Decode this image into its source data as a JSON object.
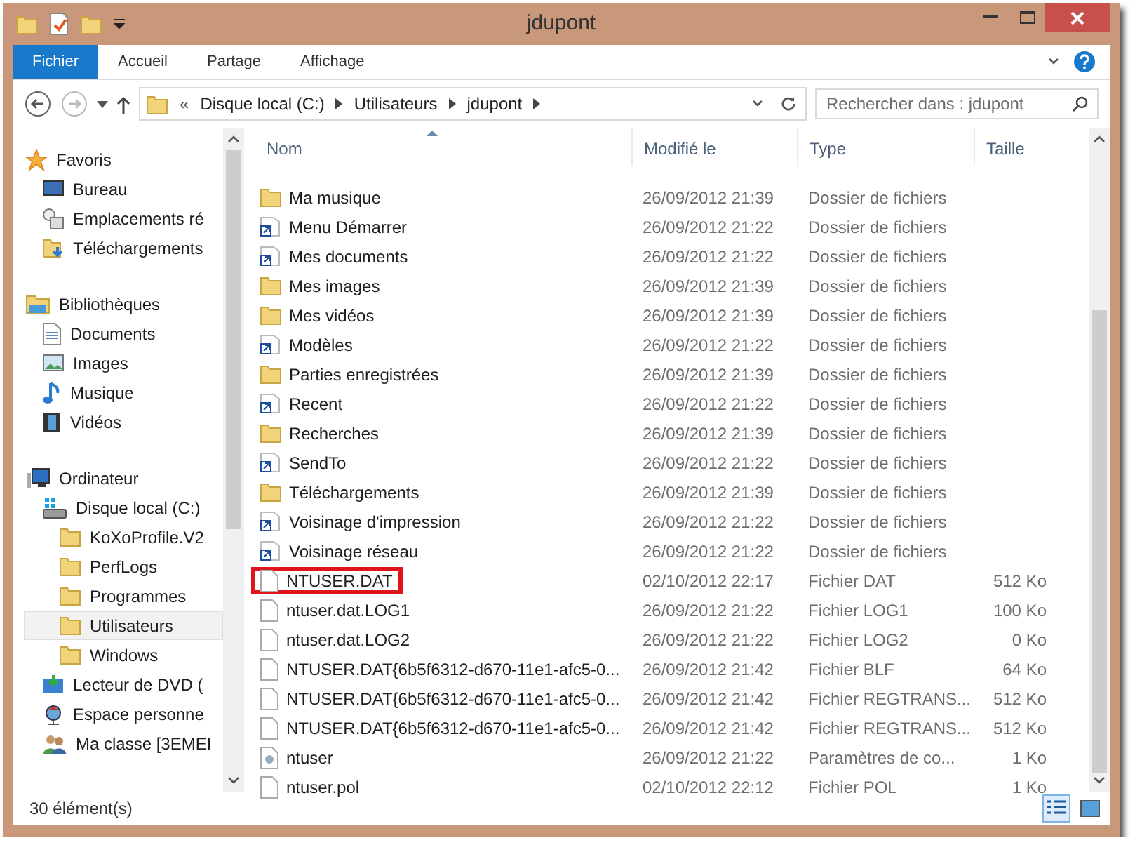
{
  "window": {
    "title": "jdupont"
  },
  "ribbon_tabs": [
    {
      "label": "Fichier",
      "selected": true
    },
    {
      "label": "Accueil",
      "selected": false
    },
    {
      "label": "Partage",
      "selected": false
    },
    {
      "label": "Affichage",
      "selected": false
    }
  ],
  "breadcrumb": {
    "overflow": "«",
    "parts": [
      "Disque local (C:)",
      "Utilisateurs",
      "jdupont"
    ]
  },
  "search": {
    "placeholder": "Rechercher dans : jdupont"
  },
  "sidebar": {
    "groups": [
      {
        "label": "Favoris",
        "kind": "star",
        "selected": false,
        "children": [
          {
            "label": "Bureau",
            "kind": "desktop",
            "selected": false
          },
          {
            "label": "Emplacements ré",
            "kind": "places",
            "selected": false
          },
          {
            "label": "Téléchargements",
            "kind": "downloads",
            "selected": false
          }
        ]
      },
      {
        "label": "Bibliothèques",
        "kind": "library",
        "selected": false,
        "children": [
          {
            "label": "Documents",
            "kind": "document",
            "selected": false
          },
          {
            "label": "Images",
            "kind": "picture",
            "selected": false
          },
          {
            "label": "Musique",
            "kind": "music",
            "selected": false
          },
          {
            "label": "Vidéos",
            "kind": "film",
            "selected": false
          }
        ]
      },
      {
        "label": "Ordinateur",
        "kind": "computer",
        "selected": false,
        "children": [
          {
            "label": "Disque local (C:)",
            "kind": "drive",
            "selected": false,
            "children": [
              {
                "label": "KoXoProfile.V2",
                "kind": "folder",
                "selected": false
              },
              {
                "label": "PerfLogs",
                "kind": "folder",
                "selected": false
              },
              {
                "label": "Programmes",
                "kind": "folder",
                "selected": false
              },
              {
                "label": "Utilisateurs",
                "kind": "folder",
                "selected": true
              },
              {
                "label": "Windows",
                "kind": "folder",
                "selected": false
              }
            ]
          },
          {
            "label": "Lecteur de DVD (",
            "kind": "dvd",
            "selected": false
          },
          {
            "label": "Espace personne",
            "kind": "network",
            "selected": false
          },
          {
            "label": "Ma classe [3EMEI",
            "kind": "users",
            "selected": false
          }
        ]
      }
    ]
  },
  "table": {
    "columns": [
      "Nom",
      "Modifié le",
      "Type",
      "Taille"
    ],
    "rows": [
      {
        "name": "Ma musique",
        "modified": "26/09/2012 21:39",
        "type": "Dossier de fichiers",
        "kind": "folder",
        "highlighted": false
      },
      {
        "name": "Menu Démarrer",
        "modified": "26/09/2012 21:22",
        "type": "Dossier de fichiers",
        "kind": "shortcut",
        "highlighted": false
      },
      {
        "name": "Mes documents",
        "modified": "26/09/2012 21:22",
        "type": "Dossier de fichiers",
        "kind": "shortcut",
        "highlighted": false
      },
      {
        "name": "Mes images",
        "modified": "26/09/2012 21:39",
        "type": "Dossier de fichiers",
        "kind": "folder",
        "highlighted": false
      },
      {
        "name": "Mes vidéos",
        "modified": "26/09/2012 21:39",
        "type": "Dossier de fichiers",
        "kind": "folder",
        "highlighted": false
      },
      {
        "name": "Modèles",
        "modified": "26/09/2012 21:22",
        "type": "Dossier de fichiers",
        "kind": "shortcut",
        "highlighted": false
      },
      {
        "name": "Parties enregistrées",
        "modified": "26/09/2012 21:39",
        "type": "Dossier de fichiers",
        "kind": "folder",
        "highlighted": false
      },
      {
        "name": "Recent",
        "modified": "26/09/2012 21:22",
        "type": "Dossier de fichiers",
        "kind": "shortcut",
        "highlighted": false
      },
      {
        "name": "Recherches",
        "modified": "26/09/2012 21:39",
        "type": "Dossier de fichiers",
        "kind": "folder",
        "highlighted": false
      },
      {
        "name": "SendTo",
        "modified": "26/09/2012 21:22",
        "type": "Dossier de fichiers",
        "kind": "shortcut",
        "highlighted": false
      },
      {
        "name": "Téléchargements",
        "modified": "26/09/2012 21:39",
        "type": "Dossier de fichiers",
        "kind": "folder",
        "highlighted": false
      },
      {
        "name": "Voisinage d'impression",
        "modified": "26/09/2012 21:22",
        "type": "Dossier de fichiers",
        "kind": "shortcut",
        "highlighted": false
      },
      {
        "name": "Voisinage réseau",
        "modified": "26/09/2012 21:22",
        "type": "Dossier de fichiers",
        "kind": "shortcut",
        "highlighted": false
      },
      {
        "name": "NTUSER.DAT",
        "modified": "02/10/2012 22:17",
        "type": "Fichier DAT",
        "size": "512 Ko",
        "kind": "file",
        "highlighted": true
      },
      {
        "name": "ntuser.dat.LOG1",
        "modified": "26/09/2012 21:22",
        "type": "Fichier LOG1",
        "size": "100 Ko",
        "kind": "file",
        "highlighted": false
      },
      {
        "name": "ntuser.dat.LOG2",
        "modified": "26/09/2012 21:22",
        "type": "Fichier LOG2",
        "size": "0 Ko",
        "kind": "file",
        "highlighted": false
      },
      {
        "name": "NTUSER.DAT{6b5f6312-d670-11e1-afc5-0...",
        "modified": "26/09/2012 21:42",
        "type": "Fichier BLF",
        "size": "64 Ko",
        "kind": "file",
        "highlighted": false
      },
      {
        "name": "NTUSER.DAT{6b5f6312-d670-11e1-afc5-0...",
        "modified": "26/09/2012 21:42",
        "type": "Fichier REGTRANS...",
        "size": "512 Ko",
        "kind": "file",
        "highlighted": false
      },
      {
        "name": "NTUSER.DAT{6b5f6312-d670-11e1-afc5-0...",
        "modified": "26/09/2012 21:42",
        "type": "Fichier REGTRANS...",
        "size": "512 Ko",
        "kind": "file",
        "highlighted": false
      },
      {
        "name": "ntuser",
        "modified": "26/09/2012 21:22",
        "type": "Paramètres de co...",
        "size": "1 Ko",
        "kind": "settings",
        "highlighted": false
      },
      {
        "name": "ntuser.pol",
        "modified": "02/10/2012 22:12",
        "type": "Fichier POL",
        "size": "1 Ko",
        "kind": "file",
        "highlighted": false
      }
    ]
  },
  "status_bar": {
    "count": "30 élément(s)"
  }
}
